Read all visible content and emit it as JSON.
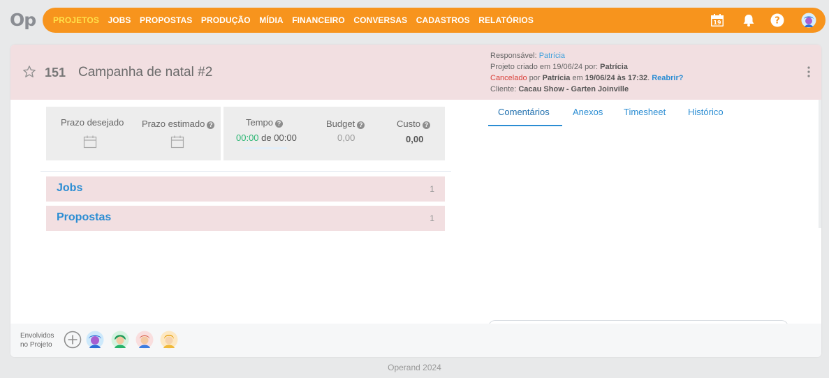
{
  "app": {
    "logo": "Op",
    "footer": "Operand 2024"
  },
  "nav": {
    "items": [
      "PROJETOS",
      "JOBS",
      "PROPOSTAS",
      "PRODUÇÃO",
      "MÍDIA",
      "FINANCEIRO",
      "CONVERSAS",
      "CADASTROS",
      "RELATÓRIOS"
    ],
    "active_index": 0,
    "calendar_day": "19",
    "accent_color": "#f7941d"
  },
  "project": {
    "number": "151",
    "name": "Campanha de natal #2",
    "responsavel_label": "Responsável:",
    "responsavel": "Patrícia",
    "criado_prefix": "Projeto criado em 19/06/24 por:",
    "criado_por": "Patrícia",
    "status": "Cancelado",
    "status_por": "por",
    "status_user": "Patrícia",
    "status_em": "em",
    "status_datetime": "19/06/24 às 17:32",
    "reopen": "Reabrir?",
    "cliente_label": "Cliente:",
    "cliente": "Cacau Show - Garten Joinville"
  },
  "stats": {
    "prazo_desejado": "Prazo desejado",
    "prazo_estimado": "Prazo estimado",
    "tempo": "Tempo",
    "tempo_used": "00:00",
    "tempo_sep": "de",
    "tempo_total": "00:00",
    "budget": "Budget",
    "budget_value": "0,00",
    "custo": "Custo",
    "custo_value": "0,00"
  },
  "sections": [
    {
      "title": "Jobs",
      "count": "1"
    },
    {
      "title": "Propostas",
      "count": "1"
    }
  ],
  "tabs": [
    "Comentários",
    "Anexos",
    "Timesheet",
    "Histórico"
  ],
  "envolvidos": {
    "label_line1": "Envolvidos",
    "label_line2": "no Projeto"
  },
  "icons": [
    "star-icon",
    "calendar-icon",
    "bell-icon",
    "help-icon",
    "more-vertical-icon",
    "add-icon"
  ]
}
